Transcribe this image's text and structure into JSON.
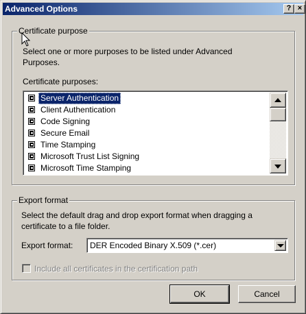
{
  "window": {
    "title": "Advanced Options",
    "help_label": "?",
    "close_label": "×"
  },
  "certificate_purpose": {
    "group_label": "Certificate purpose",
    "description_line1": "Select one or more purposes to be listed under Advanced",
    "description_line2": "Purposes.",
    "list_label": "Certificate purposes:",
    "items": [
      {
        "label": "Server Authentication",
        "checked": true,
        "selected": true
      },
      {
        "label": "Client Authentication",
        "checked": true,
        "selected": false
      },
      {
        "label": "Code Signing",
        "checked": true,
        "selected": false
      },
      {
        "label": "Secure Email",
        "checked": true,
        "selected": false
      },
      {
        "label": "Time Stamping",
        "checked": true,
        "selected": false
      },
      {
        "label": "Microsoft Trust List Signing",
        "checked": true,
        "selected": false
      },
      {
        "label": "Microsoft Time Stamping",
        "checked": true,
        "selected": false
      }
    ]
  },
  "export_format": {
    "group_label": "Export format",
    "description_line1": "Select the default drag and drop export format when dragging a",
    "description_line2": "certificate to a file folder.",
    "field_label": "Export format:",
    "selected_value": "DER Encoded Binary X.509 (*.cer)"
  },
  "include_all": {
    "label": "Include all certificates in the certification path",
    "checked": false,
    "enabled": false
  },
  "buttons": {
    "ok_label": "OK",
    "cancel_label": "Cancel"
  },
  "colors": {
    "title_gradient_start": "#0a246a",
    "title_gradient_end": "#a6caf0",
    "selection": "#0a246a",
    "face": "#d4d0c8"
  }
}
